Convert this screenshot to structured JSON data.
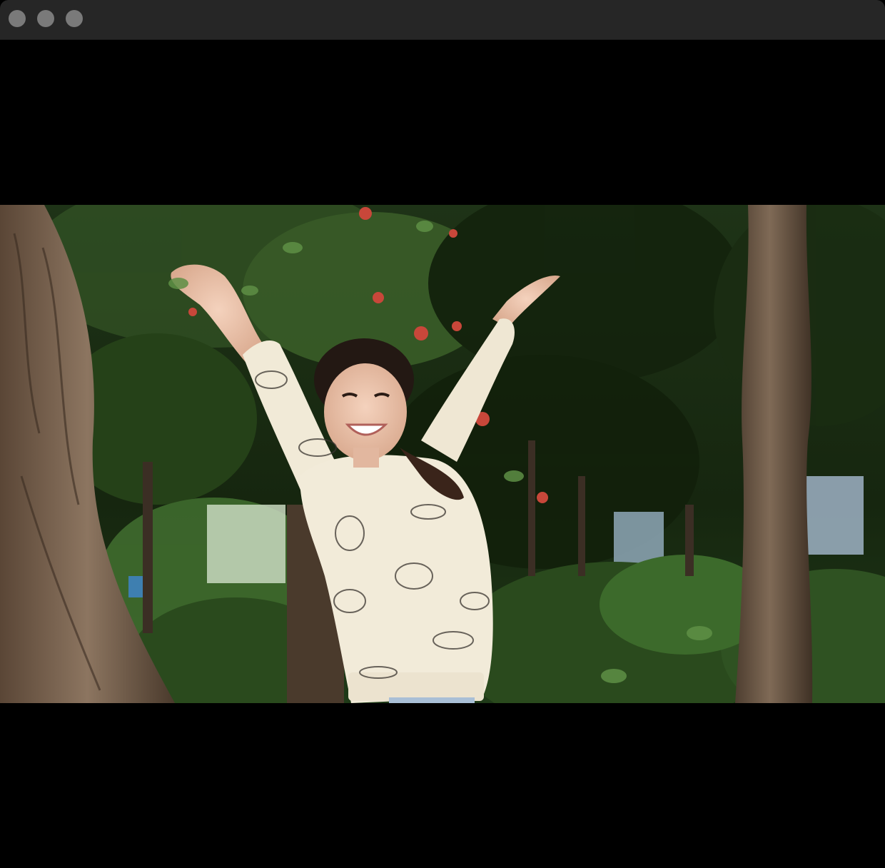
{
  "window": {
    "controls": [
      {
        "name": "close-button",
        "icon": "circle"
      },
      {
        "name": "minimize-button",
        "icon": "circle"
      },
      {
        "name": "zoom-button",
        "icon": "circle"
      }
    ],
    "controls_color": "#7a7a7a",
    "titlebar_color": "#262626",
    "background_color": "#000000"
  },
  "media": {
    "type": "photo",
    "subject": "woman-arms-raised-in-park"
  }
}
